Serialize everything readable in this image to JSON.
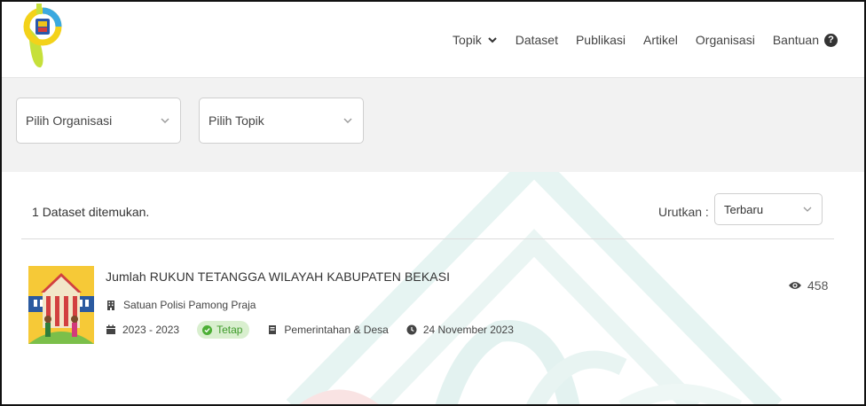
{
  "nav": {
    "items": [
      {
        "label": "Topik",
        "dropdown": true
      },
      {
        "label": "Dataset"
      },
      {
        "label": "Publikasi"
      },
      {
        "label": "Artikel"
      },
      {
        "label": "Organisasi"
      },
      {
        "label": "Bantuan",
        "help_icon": "question-circle-icon"
      }
    ]
  },
  "filters": {
    "organisasi_placeholder": "Pilih Organisasi",
    "topik_placeholder": "Pilih Topik"
  },
  "results": {
    "count": "1",
    "count_suffix": "Dataset ditemukan.",
    "sort_label": "Urutkan :",
    "sort_value": "Terbaru"
  },
  "dataset": {
    "title": "Jumlah RUKUN TETANGGA WILAYAH KABUPATEN BEKASI",
    "organization": "Satuan Polisi Pamong Praja",
    "period": "2023 - 2023",
    "status": "Tetap",
    "topic": "Pemerintahan & Desa",
    "date": "24 November 2023",
    "views": "458"
  },
  "colors": {
    "accent_green": "#4caf35",
    "watermark_teal": "#dff1ef",
    "watermark_red": "#f8dede",
    "filter_band": "#f2f2f2"
  }
}
